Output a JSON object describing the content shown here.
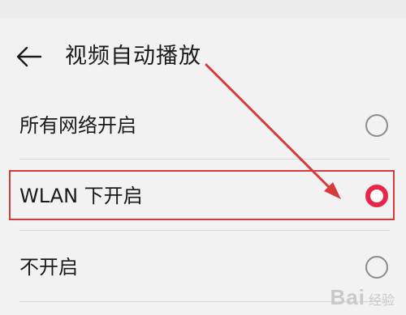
{
  "header": {
    "title": "视频自动播放",
    "back_icon": "back-arrow-icon"
  },
  "options": [
    {
      "label": "所有网络开启",
      "selected": false
    },
    {
      "label": "WLAN 下开启",
      "selected": true
    },
    {
      "label": "不开启",
      "selected": false
    }
  ],
  "colors": {
    "accent": "#e8264a",
    "annotation": "#d63b3b",
    "background": "#f2f2f2"
  },
  "watermark": {
    "main": "Bai",
    "sub": "经验"
  }
}
